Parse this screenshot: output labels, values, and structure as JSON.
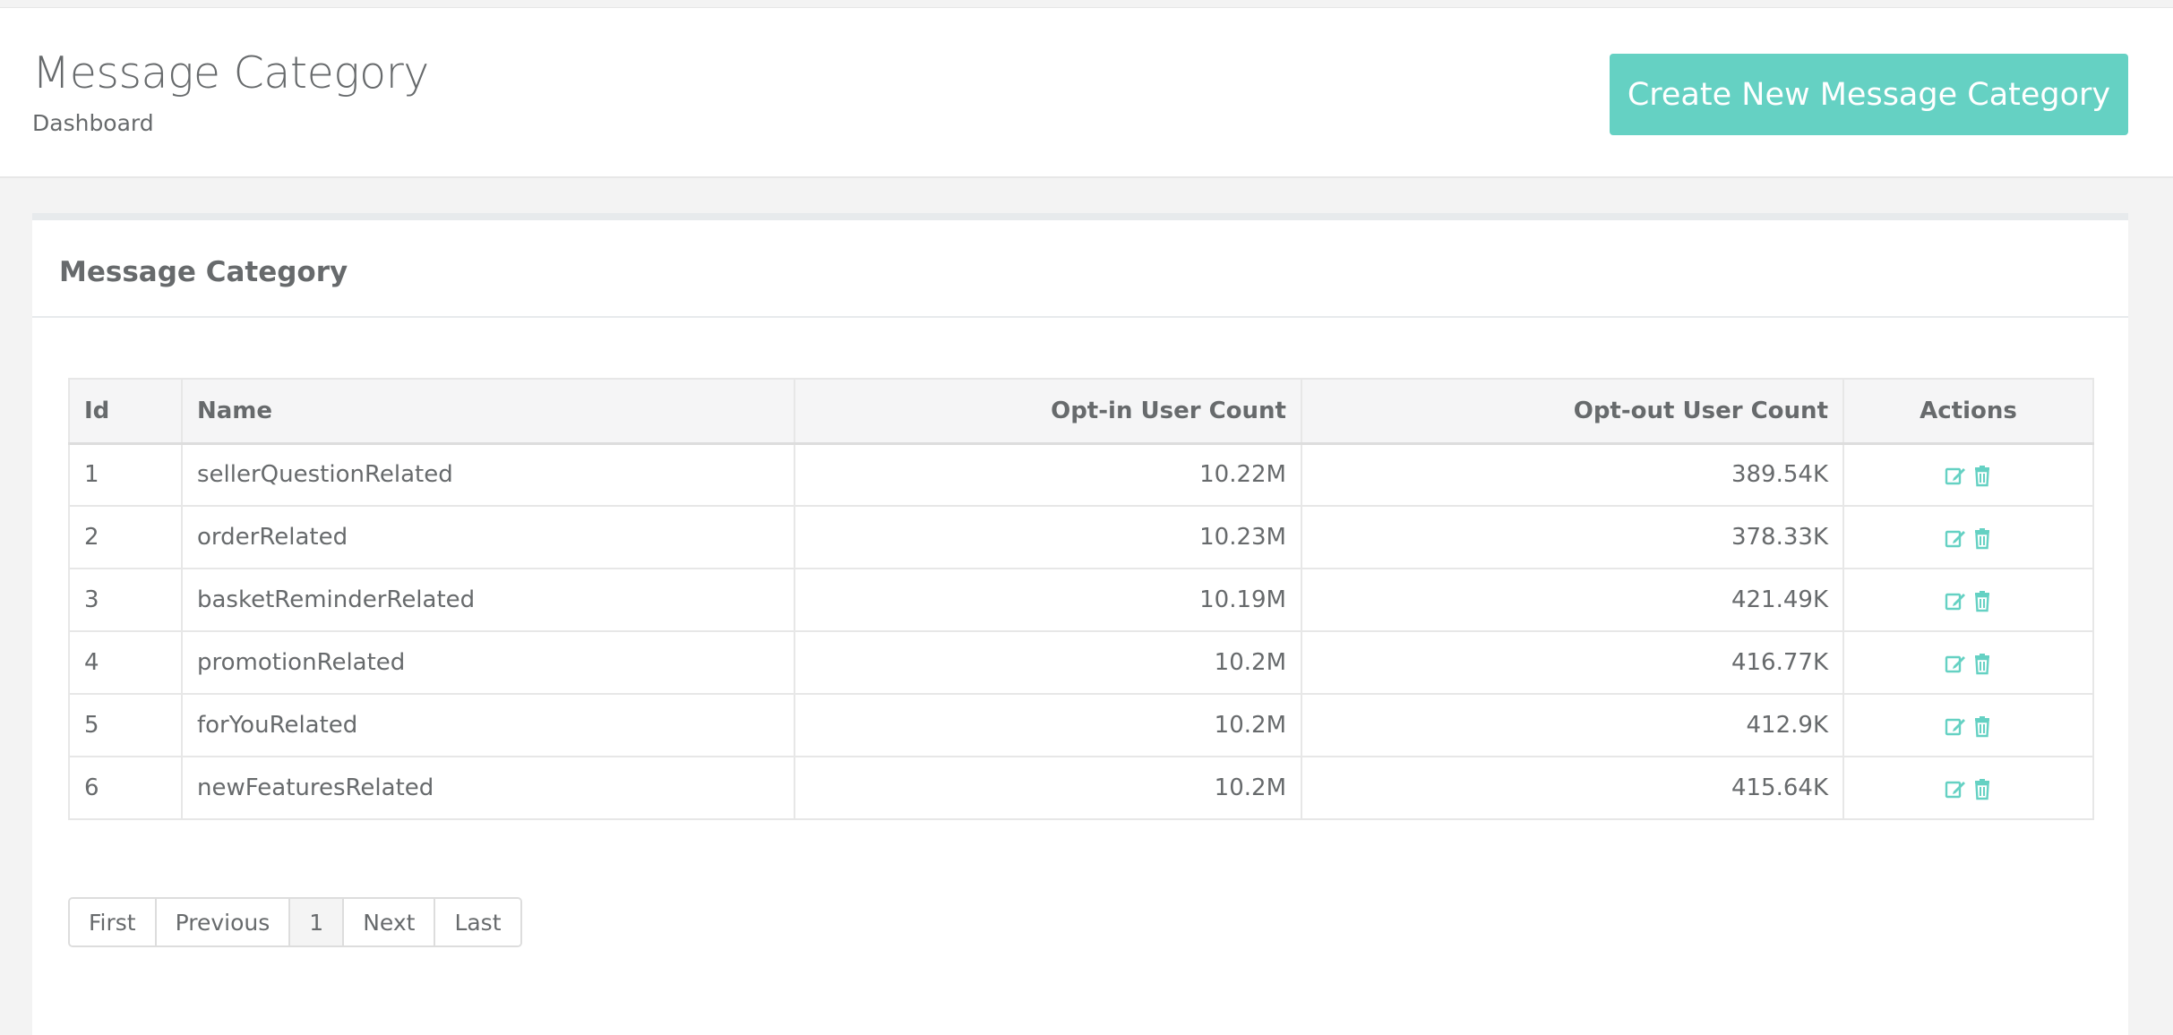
{
  "header": {
    "title": "Message Category",
    "breadcrumb": "Dashboard",
    "create_button_label": "Create New Message Category"
  },
  "panel": {
    "title": "Message Category"
  },
  "table": {
    "columns": {
      "id": "Id",
      "name": "Name",
      "optin": "Opt-in User Count",
      "optout": "Opt-out User Count",
      "actions": "Actions"
    },
    "rows": [
      {
        "id": "1",
        "name": "sellerQuestionRelated",
        "optin": "10.22M",
        "optout": "389.54K"
      },
      {
        "id": "2",
        "name": "orderRelated",
        "optin": "10.23M",
        "optout": "378.33K"
      },
      {
        "id": "3",
        "name": "basketReminderRelated",
        "optin": "10.19M",
        "optout": "421.49K"
      },
      {
        "id": "4",
        "name": "promotionRelated",
        "optin": "10.2M",
        "optout": "416.77K"
      },
      {
        "id": "5",
        "name": "forYouRelated",
        "optin": "10.2M",
        "optout": "412.9K"
      },
      {
        "id": "6",
        "name": "newFeaturesRelated",
        "optin": "10.2M",
        "optout": "415.64K"
      }
    ],
    "action_icons": [
      "edit-icon",
      "trash-icon"
    ]
  },
  "pagination": {
    "first": "First",
    "previous": "Previous",
    "current": "1",
    "next": "Next",
    "last": "Last"
  },
  "colors": {
    "accent": "#65d1c3",
    "text": "#676a6c",
    "header_bg": "#f5f5f6",
    "border": "#e7e7e7"
  }
}
